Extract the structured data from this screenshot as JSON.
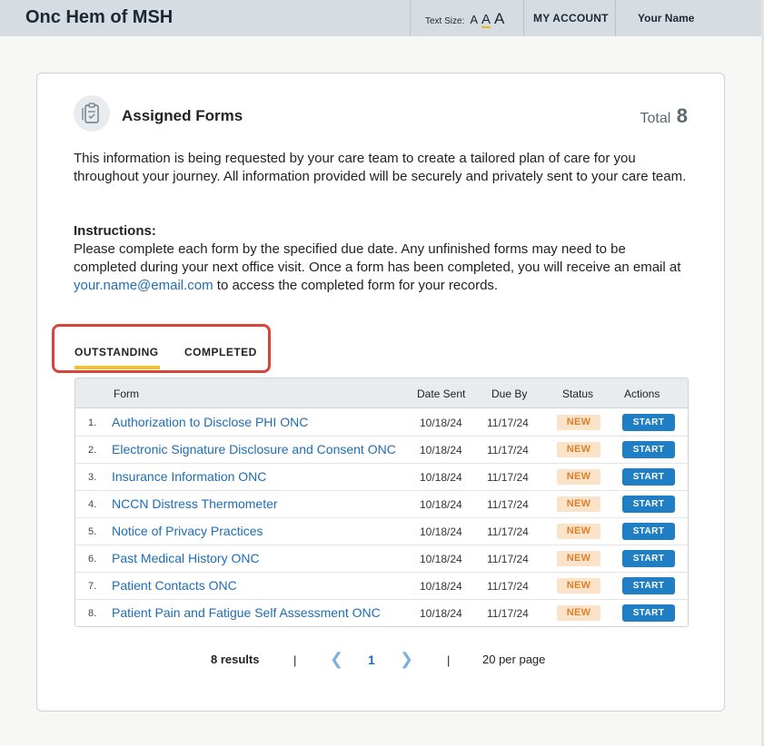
{
  "header": {
    "brand": "Onc Hem of MSH",
    "text_size_label": "Text Size:",
    "text_size_options": [
      "A",
      "A",
      "A"
    ],
    "my_account": "MY ACCOUNT",
    "user_name": "Your Name"
  },
  "card": {
    "title": "Assigned Forms",
    "total_label": "Total",
    "total_value": "8",
    "intro": "This information is being requested by your care team to create a tailored plan of care for you throughout your journey. All information provided will be securely and privately sent to your care team.",
    "instructions_heading": "Instructions:",
    "instructions_pre": "Please complete each form by the specified due date. Any unfinished forms may need to be completed during your next office visit. Once a form has been completed, you will receive an email at ",
    "email": "your.name@email.com",
    "instructions_post": " to access the completed form for your records."
  },
  "tabs": [
    {
      "label": "OUTSTANDING",
      "active": true
    },
    {
      "label": "COMPLETED",
      "active": false
    }
  ],
  "table": {
    "columns": [
      "Form",
      "Date Sent",
      "Due By",
      "Status",
      "Actions"
    ],
    "rows": [
      {
        "num": "1.",
        "name": "Authorization to Disclose PHI ONC",
        "sent": "10/18/24",
        "due": "11/17/24",
        "status": "NEW",
        "action": "START"
      },
      {
        "num": "2.",
        "name": "Electronic Signature Disclosure and Consent ONC",
        "sent": "10/18/24",
        "due": "11/17/24",
        "status": "NEW",
        "action": "START"
      },
      {
        "num": "3.",
        "name": "Insurance Information ONC",
        "sent": "10/18/24",
        "due": "11/17/24",
        "status": "NEW",
        "action": "START"
      },
      {
        "num": "4.",
        "name": "NCCN Distress Thermometer",
        "sent": "10/18/24",
        "due": "11/17/24",
        "status": "NEW",
        "action": "START"
      },
      {
        "num": "5.",
        "name": "Notice of Privacy Practices",
        "sent": "10/18/24",
        "due": "11/17/24",
        "status": "NEW",
        "action": "START"
      },
      {
        "num": "6.",
        "name": "Past Medical History ONC",
        "sent": "10/18/24",
        "due": "11/17/24",
        "status": "NEW",
        "action": "START"
      },
      {
        "num": "7.",
        "name": "Patient Contacts ONC",
        "sent": "10/18/24",
        "due": "11/17/24",
        "status": "NEW",
        "action": "START"
      },
      {
        "num": "8.",
        "name": "Patient Pain and Fatigue Self Assessment ONC",
        "sent": "10/18/24",
        "due": "11/17/24",
        "status": "NEW",
        "action": "START"
      }
    ]
  },
  "pagination": {
    "results": "8 results",
    "separator": "|",
    "current_page": "1",
    "per_page": "20 per page"
  },
  "colors": {
    "accent": "#1f7ec4",
    "link": "#1f6db4",
    "tab_underline": "#f2c12e",
    "highlight_box": "#d9443c",
    "badge_bg": "#fbe3ca",
    "badge_text": "#d9822b"
  }
}
